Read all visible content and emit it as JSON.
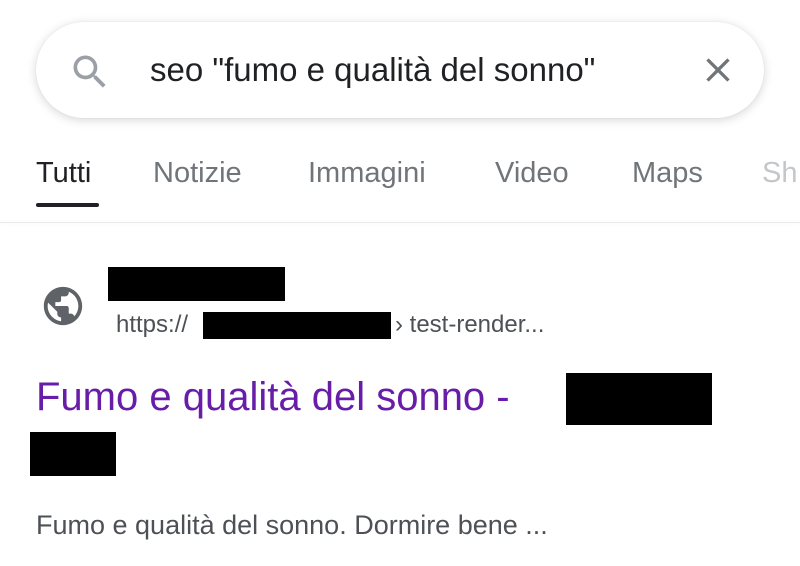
{
  "search": {
    "query": "seo \"fumo e qualità del sonno\"",
    "search_icon": "search-icon",
    "clear_icon": "close-icon"
  },
  "tabs": [
    {
      "label": "Tutti",
      "active": true
    },
    {
      "label": "Notizie",
      "active": false
    },
    {
      "label": "Immagini",
      "active": false
    },
    {
      "label": "Video",
      "active": false
    },
    {
      "label": "Maps",
      "active": false
    },
    {
      "label": "Sh",
      "active": false
    }
  ],
  "result": {
    "favicon": "globe-icon",
    "url_prefix": "https://",
    "url_suffix": "› test-render...",
    "title": "Fumo e qualità del sonno -",
    "snippet": "Fumo e qualità del sonno. Dormire bene ..."
  },
  "colors": {
    "title_visited": "#681da8",
    "text_primary": "#202124",
    "text_secondary": "#70757a",
    "redaction": "#000000"
  }
}
